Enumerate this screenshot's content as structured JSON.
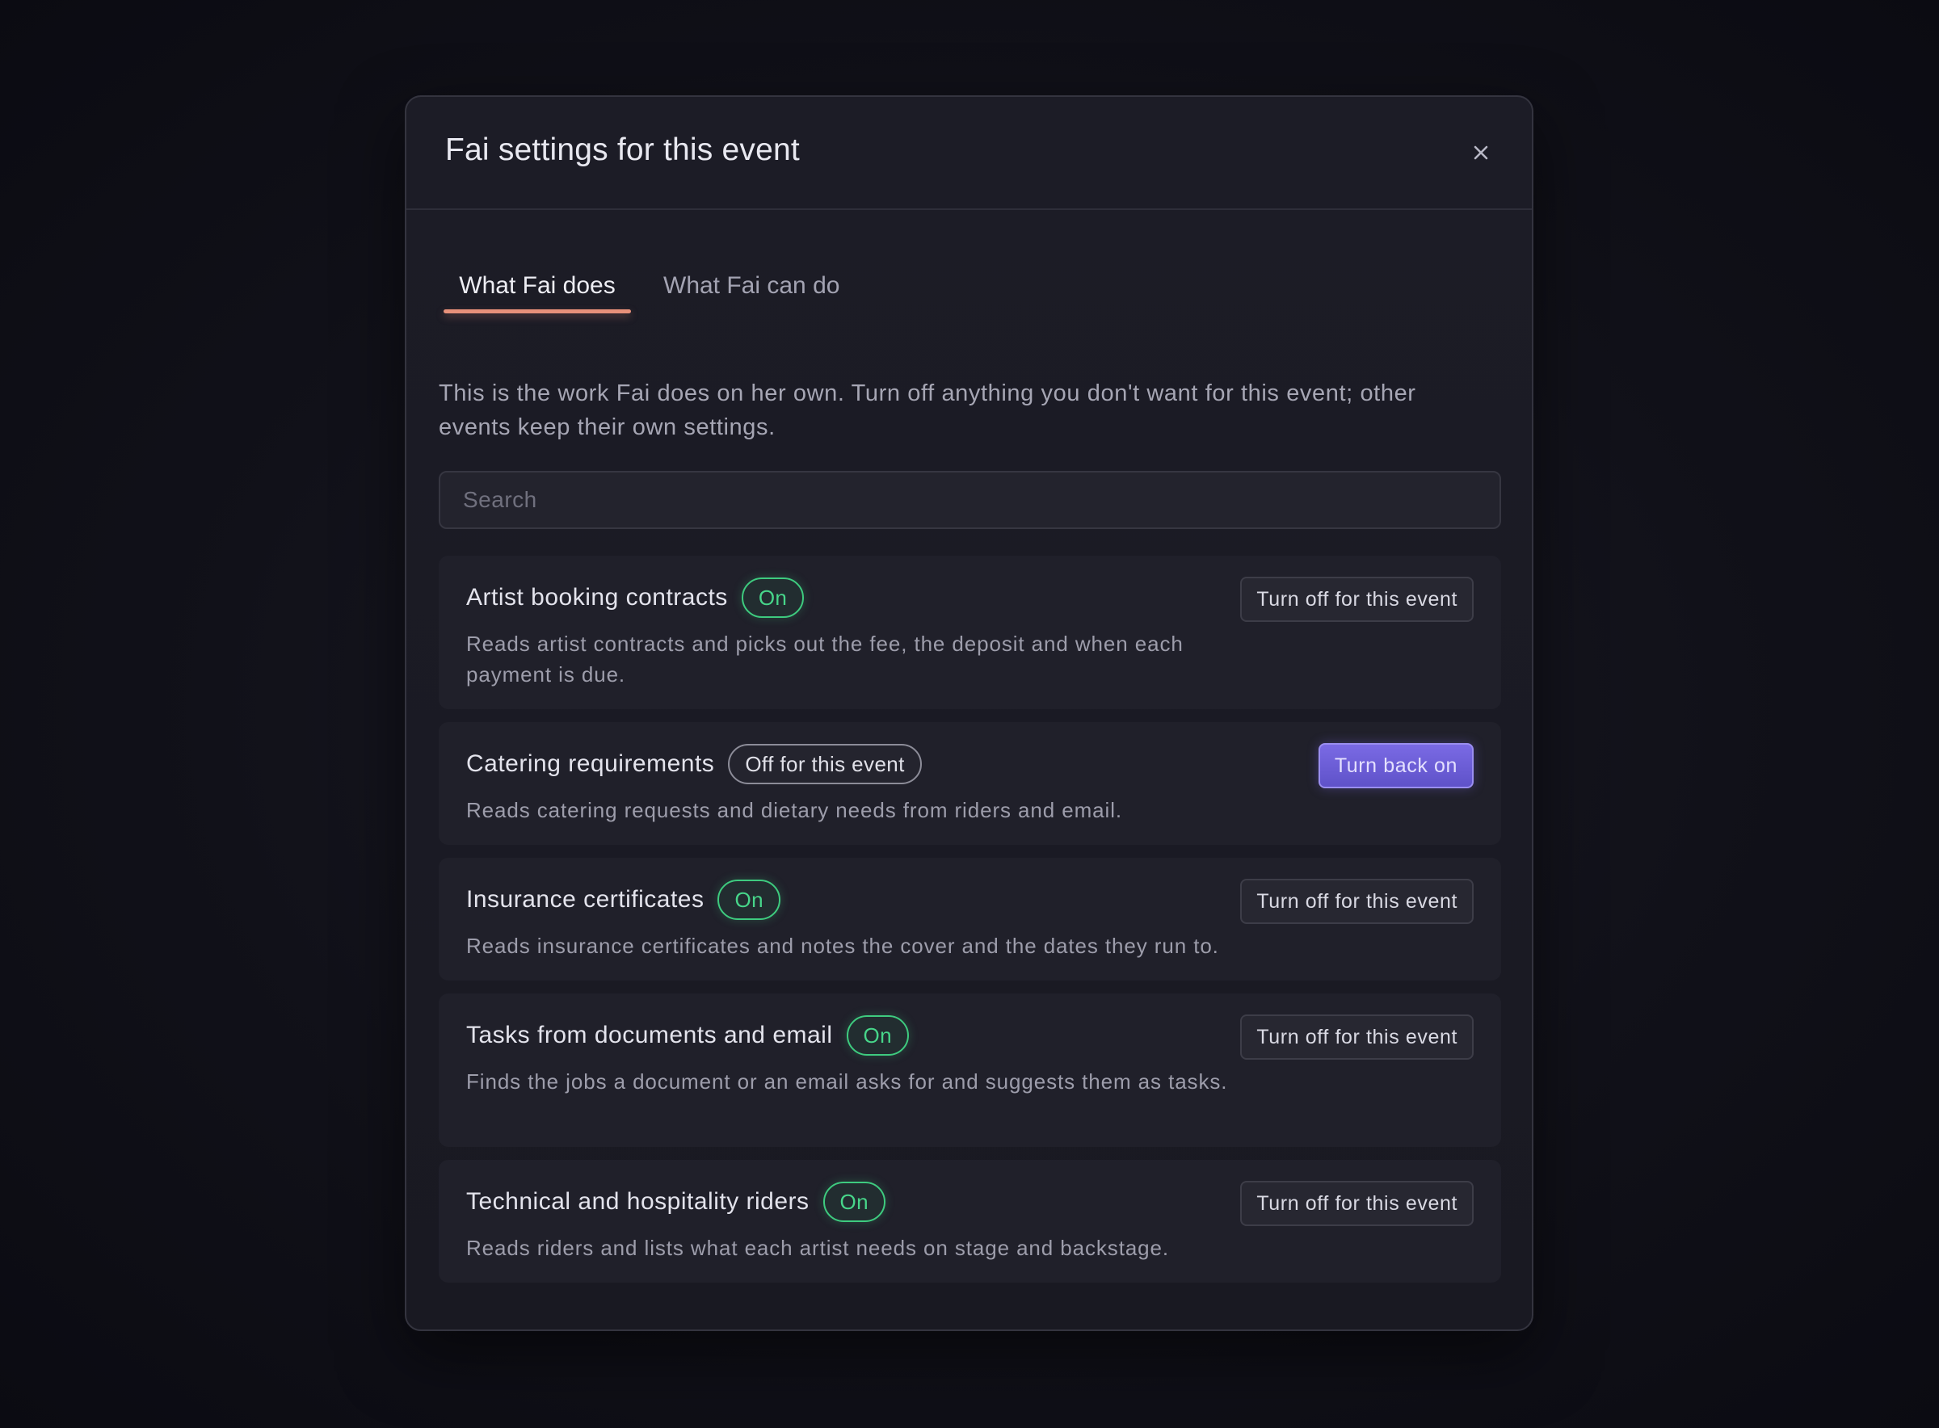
{
  "dialog": {
    "title": "Fai settings for this event",
    "close_icon": "close-icon"
  },
  "tabs": [
    {
      "label": "What Fai does",
      "active": true
    },
    {
      "label": "What Fai can do",
      "active": false
    }
  ],
  "intro": "This is the work Fai does on her own. Turn off anything you don't want for this event; other events keep their own settings.",
  "search": {
    "placeholder": "Search",
    "value": ""
  },
  "features": [
    {
      "title": "Artist booking contracts",
      "status": "On",
      "description": "Reads artist contracts and picks out the fee, the deposit and when each payment is due.",
      "action": "Turn off for this event"
    },
    {
      "title": "Catering requirements",
      "status": "Off for this event",
      "description": "Reads catering requests and dietary needs from riders and email.",
      "action": "Turn back on"
    },
    {
      "title": "Insurance certificates",
      "status": "On",
      "description": "Reads insurance certificates and notes the cover and the dates they run to.",
      "action": "Turn off for this event"
    },
    {
      "title": "Tasks from documents and email",
      "status": "On",
      "description": "Finds the jobs a document or an email asks for and suggests them as tasks.",
      "action": "Turn off for this event"
    },
    {
      "title": "Technical and hospitality riders",
      "status": "On",
      "description": "Reads riders and lists what each artist needs on stage and backstage.",
      "action": "Turn off for this event"
    }
  ],
  "colors": {
    "accent_tab": "#e8917a",
    "status_on": "#47d68a",
    "button_primary": "#6b5dd6",
    "background": "#111119",
    "surface": "#20202a"
  }
}
